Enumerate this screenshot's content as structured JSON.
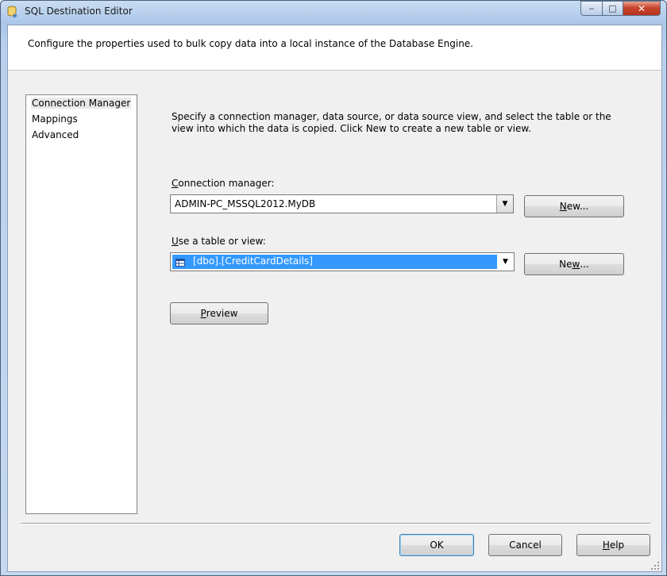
{
  "window": {
    "title": "SQL Destination Editor",
    "controls": {
      "minimize": "‒",
      "maximize": "□",
      "close": "✕"
    }
  },
  "header": {
    "text": "Configure the properties used to bulk copy data into a local instance of the Database Engine."
  },
  "nav": {
    "items": [
      {
        "label": "Connection Manager",
        "selected": true
      },
      {
        "label": "Mappings",
        "selected": false
      },
      {
        "label": "Advanced",
        "selected": false
      }
    ]
  },
  "main": {
    "description": "Specify a connection manager, data source, or data source view, and select the table or the view into which the data is copied. Click New to create a new table or view.",
    "connection_manager": {
      "label_accel": "C",
      "label_rest": "onnection manager:",
      "value": "ADMIN-PC_MSSQL2012.MyDB",
      "new_accel": "N",
      "new_rest": "ew..."
    },
    "table": {
      "label_accel": "U",
      "label_rest": "se a table or view:",
      "value": "[dbo].[CreditCardDetails]",
      "new_pre": "Ne",
      "new_accel": "w",
      "new_post": "..."
    },
    "preview": {
      "accel": "P",
      "rest": "review"
    }
  },
  "footer": {
    "ok": "OK",
    "cancel": "Cancel",
    "help_accel": "H",
    "help_rest": "elp"
  },
  "colors": {
    "selection": "#3399ff",
    "title_bar": "#aac6e8",
    "close_button": "#c7452e"
  },
  "icons": {
    "title": "database-destination-icon",
    "table": "table-icon",
    "dropdown": "chevron-down-icon"
  }
}
